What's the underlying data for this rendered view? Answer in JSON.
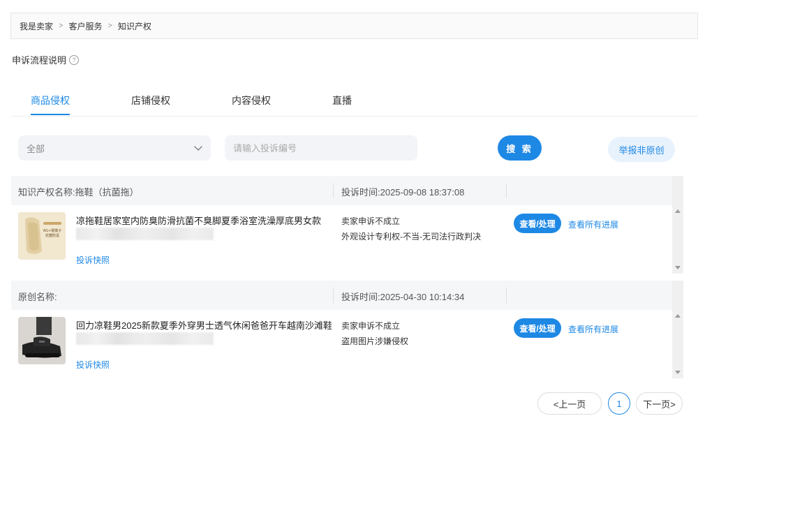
{
  "breadcrumb": {
    "items": [
      "我是卖家",
      "客户服务",
      "知识产权"
    ],
    "separator": ">"
  },
  "help": {
    "label": "申诉流程说明",
    "icon": "question-circle-icon"
  },
  "tabs": [
    {
      "label": "商品侵权",
      "active": true
    },
    {
      "label": "店铺侵权",
      "active": false
    },
    {
      "label": "内容侵权",
      "active": false
    },
    {
      "label": "直播",
      "active": false
    }
  ],
  "filters": {
    "select_value": "全部",
    "search_placeholder": "请输入投诉编号",
    "search_button": "搜 索",
    "report_button": "举报非原创"
  },
  "records": [
    {
      "name_label": "知识产权名称:拖鞋（抗菌拖）",
      "time_label": "投诉时间:2025-09-08 18:37:08",
      "product_title": "凉拖鞋居家室内防臭防滑抗菌不臭脚夏季浴室洗澡厚底男女款",
      "thumb_text": "AG+银离子 抗菌防臭",
      "snapshot_link": "投诉快照",
      "status": "卖家申诉不成立",
      "reason": "外观设计专利权-不当-无司法行政判决",
      "view_button": "查看/处理",
      "progress_link": "查看所有进展"
    },
    {
      "name_label": "原创名称:",
      "time_label": "投诉时间:2025-04-30 10:14:34",
      "product_title": "回力凉鞋男2025新款夏季外穿男士透气休闲爸爸开车越南沙滩鞋",
      "thumb_text": "",
      "snapshot_link": "投诉快照",
      "status": "卖家申诉不成立",
      "reason": "盗用图片涉嫌侵权",
      "view_button": "查看/处理",
      "progress_link": "查看所有进展"
    }
  ],
  "pagination": {
    "prev": "<上一页",
    "current": "1",
    "next": "下一页>"
  },
  "colors": {
    "accent": "#1e88e5",
    "header_bg": "#f5f6f8"
  }
}
